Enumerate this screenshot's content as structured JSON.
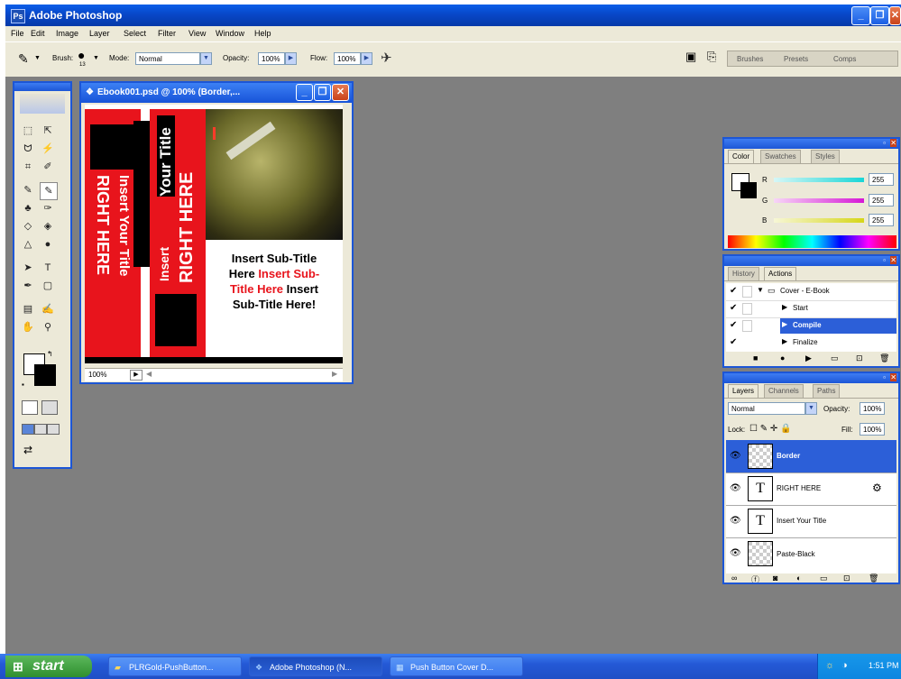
{
  "window": {
    "title": "Adobe Photoshop",
    "controls": [
      "_",
      "❐",
      "✕"
    ]
  },
  "menu": [
    "File",
    "Edit",
    "Image",
    "Layer",
    "Select",
    "Filter",
    "View",
    "Window",
    "Help"
  ],
  "options": {
    "brush_label": "Brush:",
    "brush_size": "13",
    "mode_label": "Mode:",
    "mode_value": "Normal",
    "opacity_label": "Opacity:",
    "opacity_value": "100%",
    "flow_label": "Flow:",
    "flow_value": "100%",
    "palette_tabs": [
      "Brushes",
      "Presets",
      "Comps"
    ]
  },
  "document": {
    "title": "Ebook001.psd @ 100% (Border,...",
    "zoom": "100%",
    "cover": {
      "side_title_line1": "Insert Your Title",
      "side_title_line2": "RIGHT HERE",
      "main_insert": "Insert",
      "main_your_title": "Your Title",
      "main_right_here": "RIGHT HERE",
      "subtitle_black_1": "Insert Sub-Title",
      "subtitle_black_2": "Here",
      "subtitle_red_1": "Insert Sub-",
      "subtitle_red_2": "Title Here",
      "subtitle_black_3": "Insert",
      "subtitle_black_4": "Sub-Title Here!"
    }
  },
  "color_panel": {
    "tabs": [
      "Color",
      "Swatches",
      "Styles"
    ],
    "sliders": [
      {
        "label": "R",
        "value": "255",
        "color": "#18d6d6"
      },
      {
        "label": "G",
        "value": "255",
        "color": "#d618d6"
      },
      {
        "label": "B",
        "value": "255",
        "color": "#d6d618"
      }
    ]
  },
  "actions_panel": {
    "tabs": [
      "History",
      "Actions"
    ],
    "items": [
      {
        "label": "Cover - E-Book",
        "selected": false
      },
      {
        "label": "Start",
        "selected": false
      },
      {
        "label": "Compile",
        "selected": true
      },
      {
        "label": "Finalize",
        "selected": false
      }
    ]
  },
  "layers_panel": {
    "tabs": [
      "Layers",
      "Channels",
      "Paths"
    ],
    "blend_mode": "Normal",
    "opacity_label": "Opacity:",
    "opacity_value": "100%",
    "lock_label": "Lock:",
    "fill_label": "Fill:",
    "fill_value": "100%",
    "layers": [
      {
        "name": "Border",
        "type": "raster",
        "selected": true
      },
      {
        "name": "RIGHT HERE",
        "type": "text",
        "selected": false
      },
      {
        "name": "Insert Your Title",
        "type": "text",
        "selected": false
      },
      {
        "name": "Paste-Black",
        "type": "raster",
        "selected": false
      }
    ]
  },
  "taskbar": {
    "start_label": "start",
    "buttons": [
      "PLRGold-PushButton...",
      "Adobe Photoshop (N...",
      "Push Button Cover D..."
    ],
    "clock": "1:51 PM"
  },
  "colors": {
    "xp_blue": "#1c56d6",
    "workspace_gray": "#7f7f7f",
    "cover_red": "#e8141c"
  }
}
